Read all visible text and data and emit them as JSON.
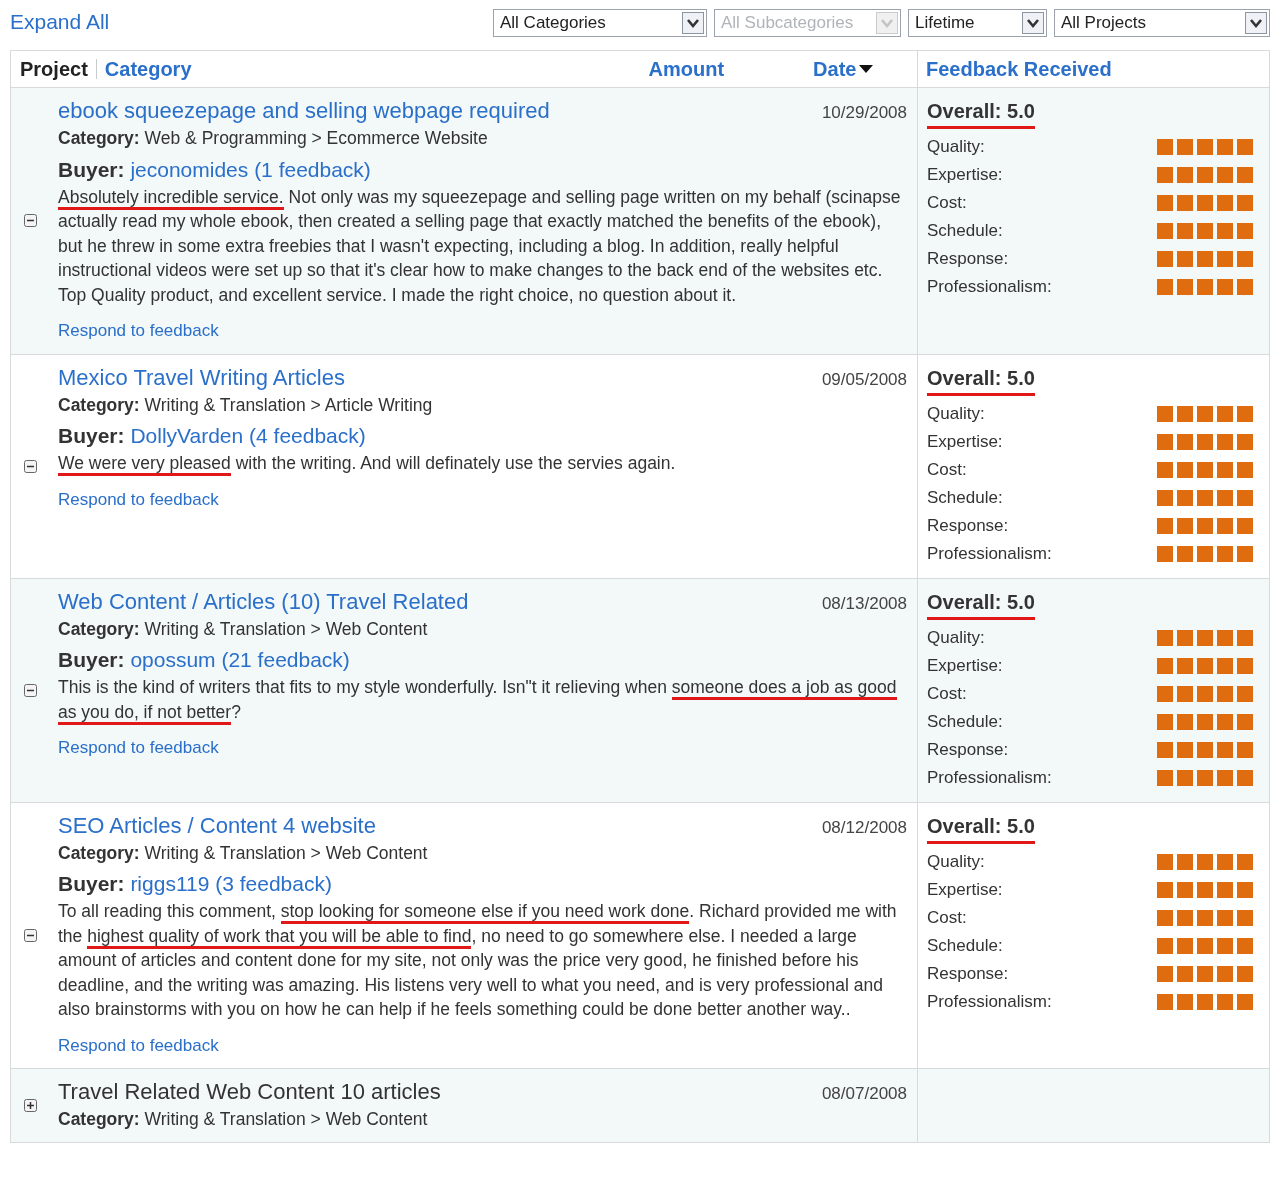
{
  "toolbar": {
    "expand_all": "Expand All",
    "filters": [
      {
        "value": "All Categories",
        "disabled": false
      },
      {
        "value": "All Subcategories",
        "disabled": true
      },
      {
        "value": "Lifetime",
        "disabled": false
      },
      {
        "value": "All Projects",
        "disabled": false
      }
    ]
  },
  "header": {
    "project": "Project",
    "category": "Category",
    "columns": [
      {
        "label": "Amount",
        "sorted": false
      },
      {
        "label": "Date",
        "sorted": true
      }
    ],
    "feedback": "Feedback Received"
  },
  "rows": [
    {
      "expanded": true,
      "title": "ebook squeezepage and selling webpage required",
      "date": "10/29/2008",
      "category_label": "Category:",
      "category": "Web & Programming > Ecommerce Website",
      "buyer_label": "Buyer:",
      "buyer": "jeconomides",
      "buyer_feedback": "(1 feedback)",
      "feedback": [
        {
          "text": "Absolutely incredible service.",
          "underlined": true
        },
        {
          "text": " Not only was my squeezepage and selling page written on my behalf (scinapse actually read my whole ebook, then created a selling page that exactly matched the benefits of the ebook), but he threw in some extra freebies that I wasn't expecting, including a blog. In addition, really helpful instructional videos were set up so that it's clear how to make changes to the back end of the websites etc. Top Quality product, and excellent service. I made the right choice, no question about it.",
          "underlined": false
        }
      ],
      "respond": "Respond to feedback",
      "rating": {
        "overall": "Overall: 5.0",
        "underlined": true,
        "criteria": [
          {
            "label": "Quality:",
            "stars": 5
          },
          {
            "label": "Expertise:",
            "stars": 5
          },
          {
            "label": "Cost:",
            "stars": 5
          },
          {
            "label": "Schedule:",
            "stars": 5
          },
          {
            "label": "Response:",
            "stars": 5
          },
          {
            "label": "Professionalism:",
            "stars": 5
          }
        ]
      }
    },
    {
      "expanded": true,
      "title": "Mexico Travel Writing Articles",
      "date": "09/05/2008",
      "category_label": "Category:",
      "category": "Writing & Translation > Article Writing",
      "buyer_label": "Buyer:",
      "buyer": "DollyVarden",
      "buyer_feedback": "(4 feedback)",
      "feedback": [
        {
          "text": "We were very pleased",
          "underlined": true
        },
        {
          "text": " with the writing. And will definately use the servies again.",
          "underlined": false
        }
      ],
      "respond": "Respond to feedback",
      "rating": {
        "overall": "Overall: 5.0",
        "underlined": true,
        "criteria": [
          {
            "label": "Quality:",
            "stars": 5
          },
          {
            "label": "Expertise:",
            "stars": 5
          },
          {
            "label": "Cost:",
            "stars": 5
          },
          {
            "label": "Schedule:",
            "stars": 5
          },
          {
            "label": "Response:",
            "stars": 5
          },
          {
            "label": "Professionalism:",
            "stars": 5
          }
        ]
      }
    },
    {
      "expanded": true,
      "title": "Web Content / Articles (10) Travel Related",
      "date": "08/13/2008",
      "category_label": "Category:",
      "category": "Writing & Translation > Web Content",
      "buyer_label": "Buyer:",
      "buyer": "opossum",
      "buyer_feedback": "(21 feedback)",
      "feedback": [
        {
          "text": "This is the kind of writers that fits to my style wonderfully. Isn\"t it relieving when ",
          "underlined": false
        },
        {
          "text": "someone does a job as good as you do, if not better",
          "underlined": true
        },
        {
          "text": "?",
          "underlined": false
        }
      ],
      "respond": "Respond to feedback",
      "rating": {
        "overall": "Overall: 5.0",
        "underlined": true,
        "criteria": [
          {
            "label": "Quality:",
            "stars": 5
          },
          {
            "label": "Expertise:",
            "stars": 5
          },
          {
            "label": "Cost:",
            "stars": 5
          },
          {
            "label": "Schedule:",
            "stars": 5
          },
          {
            "label": "Response:",
            "stars": 5
          },
          {
            "label": "Professionalism:",
            "stars": 5
          }
        ]
      }
    },
    {
      "expanded": true,
      "title": "SEO Articles / Content 4 website",
      "date": "08/12/2008",
      "category_label": "Category:",
      "category": "Writing & Translation > Web Content",
      "buyer_label": "Buyer:",
      "buyer": "riggs119",
      "buyer_feedback": "(3 feedback)",
      "feedback": [
        {
          "text": "To all reading this comment, ",
          "underlined": false
        },
        {
          "text": "stop looking for someone else if you need work done",
          "underlined": true
        },
        {
          "text": ". Richard provided me with the ",
          "underlined": false
        },
        {
          "text": "highest quality of work that you will be able to find",
          "underlined": true
        },
        {
          "text": ", no need to go somewhere else. I needed a large amount of articles and content done for my site, not only was the price very good, he finished before his deadline, and the writing was amazing. His listens very well to what you need, and is very professional and also brainstorms with you on how he can help if he feels something could be done better another way..",
          "underlined": false
        }
      ],
      "respond": "Respond to feedback",
      "rating": {
        "overall": "Overall: 5.0",
        "underlined": true,
        "criteria": [
          {
            "label": "Quality:",
            "stars": 5
          },
          {
            "label": "Expertise:",
            "stars": 5
          },
          {
            "label": "Cost:",
            "stars": 5
          },
          {
            "label": "Schedule:",
            "stars": 5
          },
          {
            "label": "Response:",
            "stars": 5
          },
          {
            "label": "Professionalism:",
            "stars": 5
          }
        ]
      }
    },
    {
      "expanded": false,
      "title": "Travel Related Web Content 10 articles",
      "date": "08/07/2008",
      "category_label": "Category:",
      "category": "Writing & Translation > Web Content"
    }
  ]
}
